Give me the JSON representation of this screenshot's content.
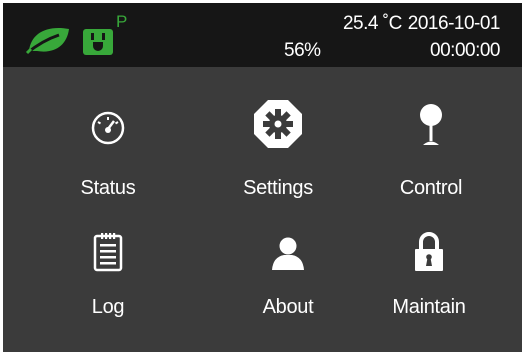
{
  "status_bar": {
    "power_tag": "P",
    "temperature": "25.4 ˚C",
    "date": "2016-10-01",
    "humidity": "56%",
    "time": "00:00:00",
    "icons": [
      "leaf-icon",
      "plug-icon"
    ],
    "accent_color": "#38a83a"
  },
  "menu": {
    "items": [
      {
        "label": "Status",
        "icon": "gauge-icon"
      },
      {
        "label": "Settings",
        "icon": "gear-icon"
      },
      {
        "label": "Control",
        "icon": "joystick-icon"
      },
      {
        "label": "Log",
        "icon": "clipboard-icon"
      },
      {
        "label": "About",
        "icon": "person-icon"
      },
      {
        "label": "Maintain",
        "icon": "lock-icon"
      }
    ]
  },
  "colors": {
    "header_bg": "#161616",
    "body_bg": "#3b3b3b",
    "text": "#ffffff"
  }
}
